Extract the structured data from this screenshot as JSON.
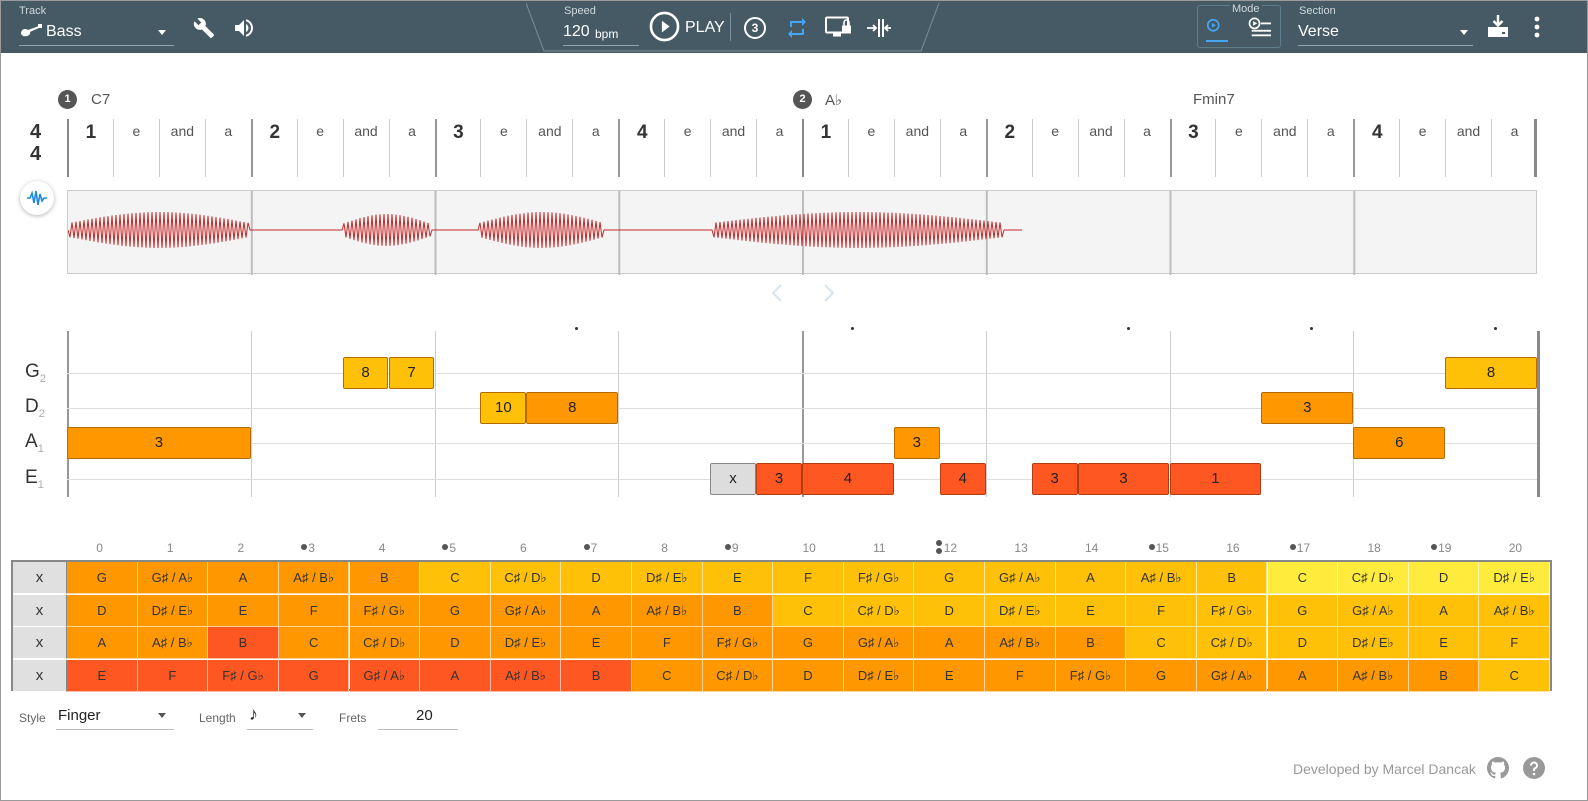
{
  "toolbar": {
    "track_label": "Track",
    "track_value": "Bass",
    "speed_label": "Speed",
    "speed_value": "120",
    "speed_unit": "bpm",
    "play_label": "PLAY",
    "countdown": "3",
    "mode_label": "Mode",
    "section_label": "Section",
    "section_value": "Verse"
  },
  "time_signature": {
    "top": "4",
    "bottom": "4"
  },
  "chords": [
    {
      "num": "1",
      "name": "C7"
    },
    {
      "num": "2",
      "name": "A♭"
    },
    {
      "num": "",
      "name": "Fmin7"
    }
  ],
  "beats": [
    "1",
    "e",
    "and",
    "a",
    "2",
    "e",
    "and",
    "a",
    "3",
    "e",
    "and",
    "a",
    "4",
    "e",
    "and",
    "a",
    "1",
    "e",
    "and",
    "a",
    "2",
    "e",
    "and",
    "a",
    "3",
    "e",
    "and",
    "a",
    "4",
    "e",
    "and",
    "a"
  ],
  "strings": [
    {
      "name": "G",
      "octave": "2"
    },
    {
      "name": "D",
      "octave": "2"
    },
    {
      "name": "A",
      "octave": "1"
    },
    {
      "name": "E",
      "octave": "1"
    }
  ],
  "notes": [
    {
      "string": 0,
      "start": 6,
      "len": 1,
      "fret": "8",
      "color": "y"
    },
    {
      "string": 0,
      "start": 7,
      "len": 1,
      "fret": "7",
      "color": "y"
    },
    {
      "string": 0,
      "start": 30,
      "len": 2,
      "fret": "8",
      "color": "y"
    },
    {
      "string": 1,
      "start": 9,
      "len": 1,
      "fret": "10",
      "color": "y"
    },
    {
      "string": 1,
      "start": 10,
      "len": 2,
      "fret": "8",
      "color": "o"
    },
    {
      "string": 1,
      "start": 26,
      "len": 2,
      "fret": "3",
      "color": "o"
    },
    {
      "string": 2,
      "start": 0,
      "len": 4,
      "fret": "3",
      "color": "o"
    },
    {
      "string": 2,
      "start": 18,
      "len": 1,
      "fret": "3",
      "color": "o"
    },
    {
      "string": 2,
      "start": 28,
      "len": 2,
      "fret": "6",
      "color": "o"
    },
    {
      "string": 3,
      "start": 14,
      "len": 1,
      "fret": "x",
      "color": "x"
    },
    {
      "string": 3,
      "start": 15,
      "len": 1,
      "fret": "3",
      "color": "r"
    },
    {
      "string": 3,
      "start": 16,
      "len": 2,
      "fret": "4",
      "color": "r"
    },
    {
      "string": 3,
      "start": 19,
      "len": 1,
      "fret": "4",
      "color": "r"
    },
    {
      "string": 3,
      "start": 21,
      "len": 1,
      "fret": "3",
      "color": "r"
    },
    {
      "string": 3,
      "start": 22,
      "len": 2,
      "fret": "3",
      "color": "r"
    },
    {
      "string": 3,
      "start": 24,
      "len": 2,
      "fret": "1",
      "color": "r"
    }
  ],
  "fret_numbers": [
    "0",
    "1",
    "2",
    "3",
    "4",
    "5",
    "6",
    "7",
    "8",
    "9",
    "10",
    "11",
    "12",
    "13",
    "14",
    "15",
    "16",
    "17",
    "18",
    "19",
    "20"
  ],
  "fret_markers": [
    3,
    5,
    7,
    9,
    12,
    15,
    17,
    19
  ],
  "fretboard": {
    "mute_label": "x",
    "rows": [
      [
        "G",
        "G♯ / A♭",
        "A",
        "A♯ / B♭",
        "B",
        "C",
        "C♯ / D♭",
        "D",
        "D♯ / E♭",
        "E",
        "F",
        "F♯ / G♭",
        "G",
        "G♯ / A♭",
        "A",
        "A♯ / B♭",
        "B",
        "C",
        "C♯ / D♭",
        "D",
        "D♯ / E♭"
      ],
      [
        "D",
        "D♯ / E♭",
        "E",
        "F",
        "F♯ / G♭",
        "G",
        "G♯ / A♭",
        "A",
        "A♯ / B♭",
        "B",
        "C",
        "C♯ / D♭",
        "D",
        "D♯ / E♭",
        "E",
        "F",
        "F♯ / G♭",
        "G",
        "G♯ / A♭",
        "A",
        "A♯ / B♭"
      ],
      [
        "A",
        "A♯ / B♭",
        "B",
        "C",
        "C♯ / D♭",
        "D",
        "D♯ / E♭",
        "E",
        "F",
        "F♯ / G♭",
        "G",
        "G♯ / A♭",
        "A",
        "A♯ / B♭",
        "B",
        "C",
        "C♯ / D♭",
        "D",
        "D♯ / E♭",
        "E",
        "F"
      ],
      [
        "E",
        "F",
        "F♯ / G♭",
        "G",
        "G♯ / A♭",
        "A",
        "A♯ / B♭",
        "B",
        "C",
        "C♯ / D♭",
        "D",
        "D♯ / E♭",
        "E",
        "F",
        "F♯ / G♭",
        "G",
        "G♯ / A♭",
        "A",
        "A♯ / B♭",
        "B",
        "C"
      ]
    ],
    "colors": [
      [
        "#ff9800",
        "#ff9800",
        "#ff9800",
        "#ff9800",
        "#ff9800",
        "#ffc107",
        "#ffc107",
        "#ffc107",
        "#ffc107",
        "#ffc107",
        "#ffc107",
        "#ffc107",
        "#ffc107",
        "#ffc107",
        "#ffc107",
        "#ffc107",
        "#ffc107",
        "#ffeb3b",
        "#ffeb3b",
        "#ffeb3b",
        "#ffeb3b"
      ],
      [
        "#ff9800",
        "#ff9800",
        "#ff9800",
        "#ff9800",
        "#ff9800",
        "#ff9800",
        "#ff9800",
        "#ff9800",
        "#ff9800",
        "#ff9800",
        "#ffc107",
        "#ffc107",
        "#ffc107",
        "#ffc107",
        "#ffc107",
        "#ffc107",
        "#ffc107",
        "#ffc107",
        "#ffc107",
        "#ffc107",
        "#ffc107"
      ],
      [
        "#ff9800",
        "#ff9800",
        "#ff5722",
        "#ff9800",
        "#ff9800",
        "#ff9800",
        "#ff9800",
        "#ff9800",
        "#ff9800",
        "#ff9800",
        "#ff9800",
        "#ff9800",
        "#ff9800",
        "#ff9800",
        "#ff9800",
        "#ffc107",
        "#ffc107",
        "#ffc107",
        "#ffc107",
        "#ffc107",
        "#ffc107"
      ],
      [
        "#ff5722",
        "#ff5722",
        "#ff5722",
        "#ff5722",
        "#ff5722",
        "#ff5722",
        "#ff5722",
        "#ff5722",
        "#ff9800",
        "#ff9800",
        "#ff9800",
        "#ff9800",
        "#ff9800",
        "#ff9800",
        "#ff9800",
        "#ff9800",
        "#ff9800",
        "#ff9800",
        "#ff9800",
        "#ff9800",
        "#ffc107"
      ]
    ]
  },
  "bottom": {
    "style_label": "Style",
    "style_value": "Finger",
    "length_label": "Length",
    "length_value": "♪",
    "frets_label": "Frets",
    "frets_value": "20",
    "credit": "Developed by Marcel Dancak"
  },
  "colors": {
    "toolbar": "#455a64",
    "accent": "#1e88e5",
    "wave": "#c62828"
  }
}
